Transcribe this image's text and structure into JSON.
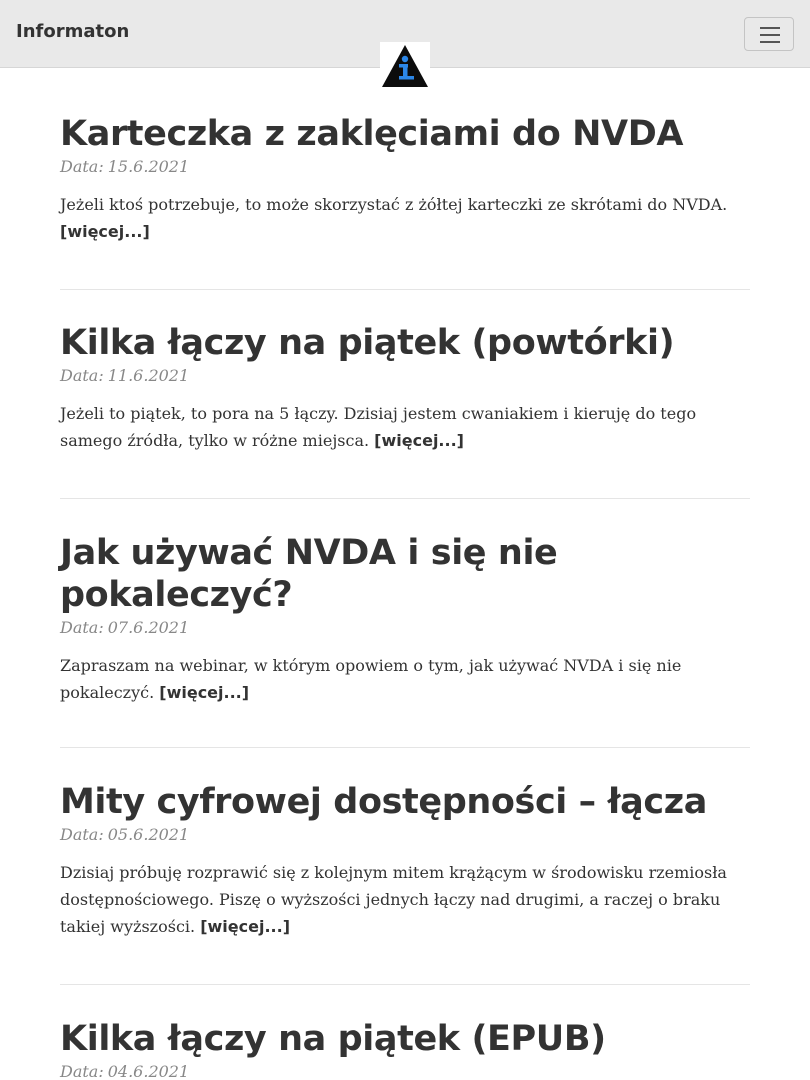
{
  "navbar": {
    "brand": "Informaton",
    "toggle_icon": "hamburger-menu-icon",
    "logo_icon": "info-triangle-logo"
  },
  "colors": {
    "navbar_bg": "#e9e9e9",
    "text": "#333333",
    "date": "#888888",
    "logo_blue": "#2c87e8"
  },
  "date_label": "Data:",
  "more_label": "[więcej...]",
  "posts": [
    {
      "title": "Karteczka z zaklęciami do NVDA",
      "date": "15.6.2021",
      "excerpt": "Jeżeli ktoś potrzebuje, to może skorzystać z żółtej karteczki ze skrótami do NVDA."
    },
    {
      "title": "Kilka łączy na piątek (powtórki)",
      "date": "11.6.2021",
      "excerpt": "Jeżeli to piątek, to pora na 5 łączy. Dzisiaj jestem cwaniakiem i kieruję do tego samego źródła, tylko w różne miejsca."
    },
    {
      "title": "Jak używać NVDA i się nie pokaleczyć?",
      "date": "07.6.2021",
      "excerpt": "Zapraszam na webinar, w którym opowiem o tym, jak używać NVDA i się nie pokaleczyć."
    },
    {
      "title": "Mity cyfrowej dostępności – łącza",
      "date": "05.6.2021",
      "excerpt": "Dzisiaj próbuję rozprawić się z kolejnym mitem krążącym w środowisku rzemiosła dostępnościowego. Piszę o wyższości jednych łączy nad drugimi, a raczej o braku takiej wyższości."
    },
    {
      "title": "Kilka łączy na piątek (EPUB)",
      "date": "04.6.2021",
      "excerpt": ""
    }
  ]
}
